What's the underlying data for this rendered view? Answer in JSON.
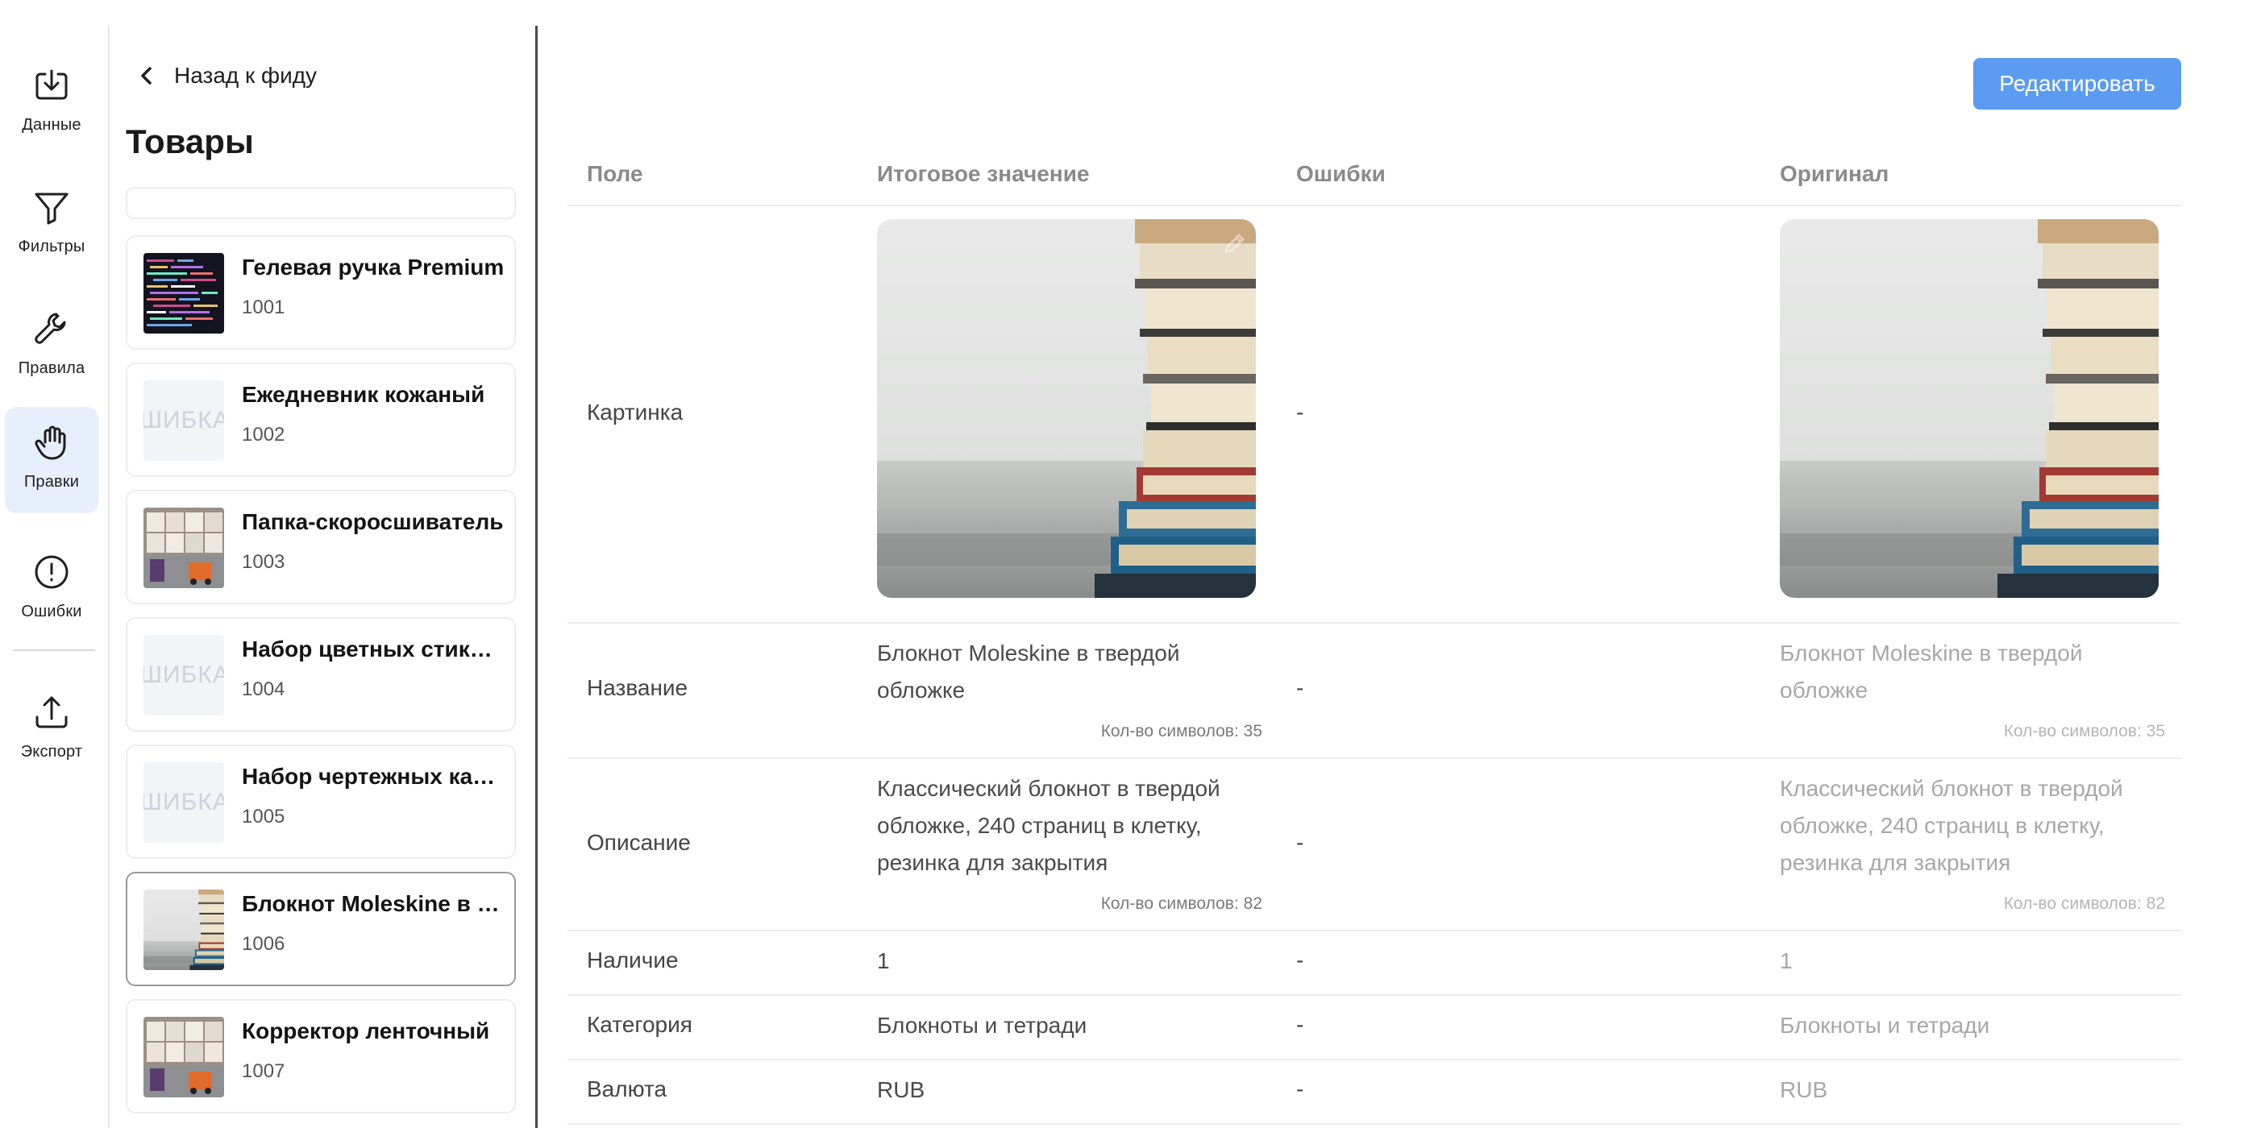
{
  "rail": {
    "items": [
      {
        "label": "Данные",
        "icon": "download-icon"
      },
      {
        "label": "Фильтры",
        "icon": "filter-icon"
      },
      {
        "label": "Правила",
        "icon": "wrench-icon"
      },
      {
        "label": "Правки",
        "icon": "hand-icon",
        "active": true
      },
      {
        "label": "Ошибки",
        "icon": "alert-circle-icon"
      },
      {
        "label": "Экспорт",
        "icon": "upload-icon"
      }
    ]
  },
  "list": {
    "back_label": "Назад к фиду",
    "title": "Товары",
    "search_placeholder": "",
    "products": [
      {
        "title": "Гелевая ручка Premium",
        "id": "1001",
        "thumb": "code-photo"
      },
      {
        "title": "Ежедневник кожаный",
        "id": "1002",
        "thumb": "error",
        "thumb_text": "ОШИБКА"
      },
      {
        "title": "Папка-скоросшиватель",
        "id": "1003",
        "thumb": "warehouse-photo"
      },
      {
        "title": "Набор цветных стикеров",
        "id": "1004",
        "thumb": "error",
        "thumb_text": "ОШИБКА"
      },
      {
        "title": "Набор чертежных карандашей",
        "id": "1005",
        "thumb": "error",
        "thumb_text": "ОШИБКА"
      },
      {
        "title": "Блокнот Moleskine в твердой обложке",
        "id": "1006",
        "thumb": "books-photo",
        "selected": true
      },
      {
        "title": "Корректор ленточный",
        "id": "1007",
        "thumb": "warehouse-photo"
      }
    ]
  },
  "main": {
    "edit_label": "Редактировать",
    "columns": {
      "field": "Поле",
      "value": "Итоговое значение",
      "errors": "Ошибки",
      "original": "Оригинал"
    },
    "rows": {
      "image": {
        "field": "Картинка",
        "error": "-"
      },
      "name": {
        "field": "Название",
        "value": "Блокнот Moleskine в твердой обложке",
        "count": "Кол-во символов: 35",
        "error": "-",
        "original": "Блокнот Moleskine в твердой обложке",
        "original_count": "Кол-во символов: 35"
      },
      "description": {
        "field": "Описание",
        "value": "Классический блокнот в твердой обложке, 240 страниц в клетку, резинка для закрытия",
        "count": "Кол-во символов: 82",
        "error": "-",
        "original": "Классический блокнот в твердой обложке, 240 страниц в клетку, резинка для закрытия",
        "original_count": "Кол-во символов: 82"
      },
      "availability": {
        "field": "Наличие",
        "value": "1",
        "error": "-",
        "original": "1"
      },
      "category": {
        "field": "Категория",
        "value": "Блокноты и тетради",
        "error": "-",
        "original": "Блокноты и тетради"
      },
      "currency": {
        "field": "Валюта",
        "value": "RUB",
        "error": "-",
        "original": "RUB"
      }
    }
  },
  "colors": {
    "accent": "#5b9cf2",
    "active_bg": "#e8effc"
  }
}
